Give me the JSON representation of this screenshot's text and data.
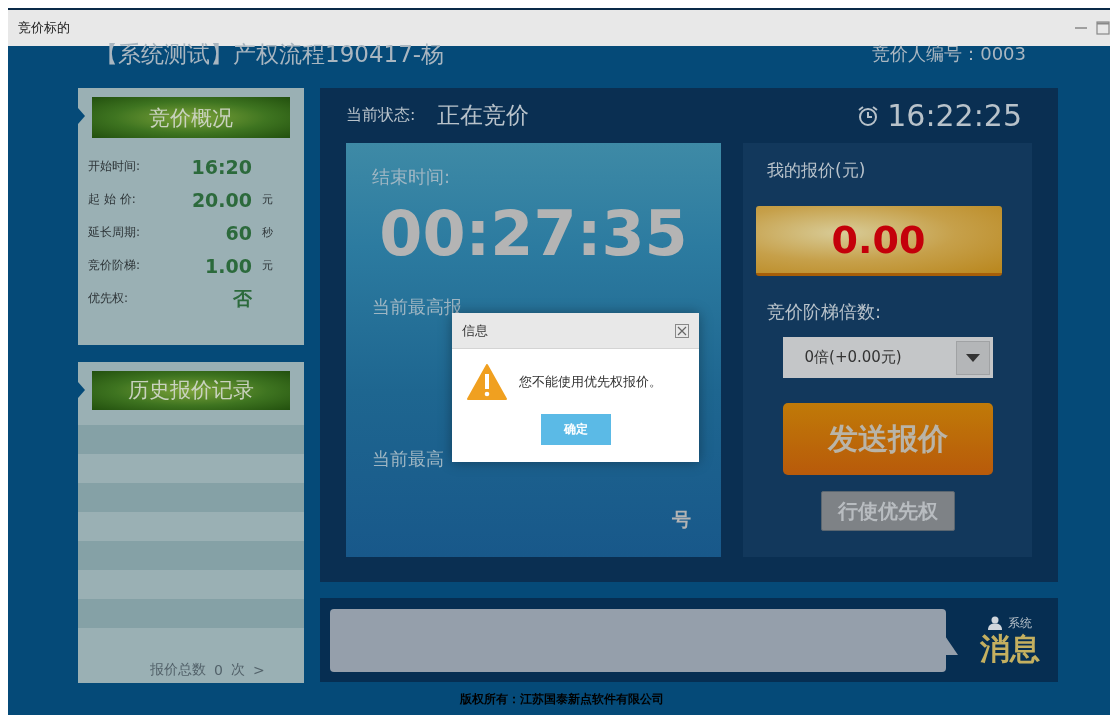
{
  "window": {
    "title": "竞价标的"
  },
  "header": {
    "project_title": "【系统测试】产权流程190417-杨",
    "bidder_number": "竞价人编号：0003"
  },
  "overview": {
    "title": "竞价概况",
    "rows": [
      {
        "label": "开始时间:",
        "value": "16:20"
      },
      {
        "label": "起 始 价:",
        "value": "20.00",
        "unit": "元"
      },
      {
        "label": "延长周期:",
        "value": "60",
        "unit": "秒"
      },
      {
        "label": "竞价阶梯:",
        "value": "1.00",
        "unit": "元"
      },
      {
        "label": "优先权:",
        "value": "否"
      }
    ]
  },
  "history": {
    "title": "历史报价记录",
    "total_label": "报价总数",
    "total": "0",
    "total_unit": "次",
    "next": ">"
  },
  "status": {
    "label": "当前状态:",
    "value": "正在竞价",
    "clock": "16:22:25"
  },
  "countdown": {
    "label": "结束时间:",
    "time": "00:27:35",
    "highest_bid_label": "当前最高报",
    "highest_bidder_label": "当前最高",
    "bidder_suffix": "号"
  },
  "my_bid": {
    "label": "我的报价(元)",
    "value": "0.00",
    "step_label": "竞价阶梯倍数:",
    "step_value": "0倍(+0.00元)",
    "send_button": "发送报价",
    "priority_button": {
      "label": "行使优先权",
      "disabled": true
    }
  },
  "messages": {
    "sender": "系统",
    "title": "消息"
  },
  "copyright": "版权所有：江苏国泰新点软件有限公司",
  "dialog": {
    "title": "信息",
    "message": "您不能使用优先权报价。",
    "ok_button": "确定"
  }
}
